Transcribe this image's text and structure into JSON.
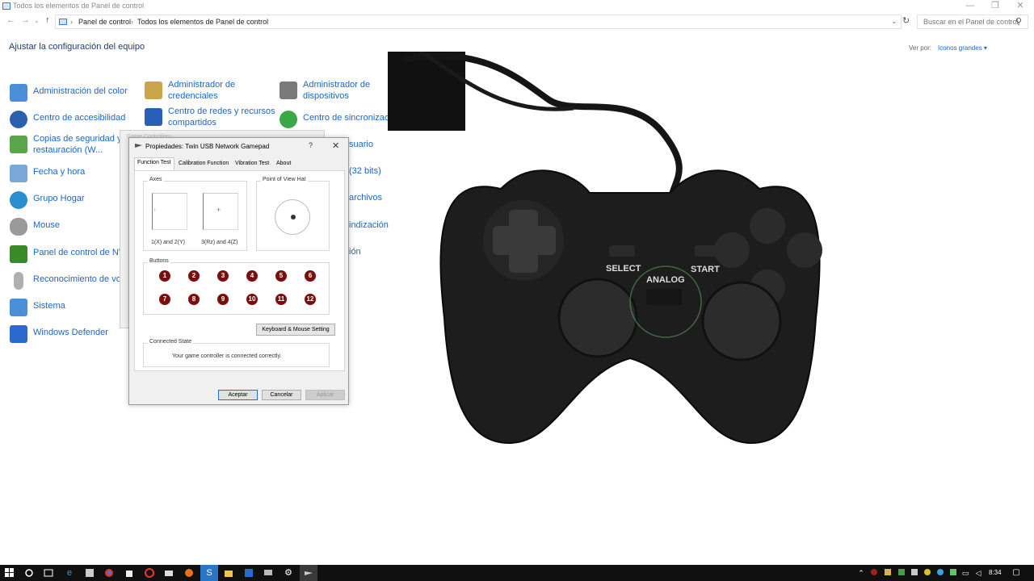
{
  "window": {
    "title": "Todos los elementos de Panel de control",
    "minimize": "—",
    "restore": "❐",
    "close": "✕"
  },
  "address": {
    "back": "←",
    "forward": "→",
    "recent": "⌄",
    "up": "↑",
    "crumbs": [
      "Panel de control",
      "Todos los elementos de Panel de control"
    ],
    "separator": "›",
    "dropdown": "⌄",
    "refresh": "↻",
    "search_placeholder": "Buscar en el Panel de control",
    "search_glyph": "⚲"
  },
  "page": {
    "heading": "Ajustar la configuración del equipo",
    "view_by_label": "Ver por:",
    "view_by_value": "Iconos grandes ▾"
  },
  "items": [
    {
      "label": "Administración del color",
      "icon": "color-management-icon",
      "color": "#4a8fd8"
    },
    {
      "label": "Centro de accesibilidad",
      "icon": "accessibility-icon",
      "color": "#2b5fb0"
    },
    {
      "label": "Copias de seguridad y\nrestauración (W...",
      "icon": "backup-icon",
      "color": "#5aa54a"
    },
    {
      "label": "Fecha y hora",
      "icon": "clock-icon",
      "color": "#7aa7d6"
    },
    {
      "label": "Grupo Hogar",
      "icon": "homegroup-icon",
      "color": "#2a8fd0"
    },
    {
      "label": "Mouse",
      "icon": "mouse-icon",
      "color": "#9a9a9a"
    },
    {
      "label": "Panel de control de NVI",
      "icon": "nvidia-icon",
      "color": "#3a8a2a"
    },
    {
      "label": "Reconocimiento de voz",
      "icon": "microphone-icon",
      "color": "#b0b0b0"
    },
    {
      "label": "Sistema",
      "icon": "system-icon",
      "color": "#4a8fd8"
    },
    {
      "label": "Windows Defender",
      "icon": "defender-icon",
      "color": "#2a6ad0"
    },
    {
      "label": "Administrador de\ncredenciales",
      "icon": "credentials-icon",
      "color": "#c9a64a"
    },
    {
      "label": "Centro de redes y recursos\ncompartidos",
      "icon": "network-icon",
      "color": "#2a5fb8"
    },
    {
      "label": "Administrador de\ndispositivos",
      "icon": "device-manager-icon",
      "color": "#7a7a7a"
    },
    {
      "label": "Centro de sincronizació",
      "icon": "sync-icon",
      "color": "#3aa844"
    },
    {
      "label": "suario",
      "icon": "",
      "color": ""
    },
    {
      "label": "(32 bits)",
      "icon": "",
      "color": ""
    },
    {
      "label": "archivos",
      "icon": "",
      "color": ""
    },
    {
      "label": "indización",
      "icon": "",
      "color": ""
    },
    {
      "label": "ión",
      "icon": "",
      "color": ""
    }
  ],
  "ghost_dialog": {
    "title": "Game Controllers"
  },
  "dialog": {
    "title": "Propiedades: Twin USB Network Gamepad",
    "help": "?",
    "close": "✕",
    "tabs": [
      "Function Test",
      "Calibration Function",
      "Vibration Test",
      "About"
    ],
    "axes_label": "Axes",
    "axis1_label": "1(X) and 2(Y)",
    "axis2_label": "3(Rz) and 4(Z)",
    "axis_marker": "+",
    "pov_label": "Point of View Hat",
    "buttons_label": "Buttons",
    "buttons": [
      "1",
      "2",
      "3",
      "4",
      "5",
      "6",
      "7",
      "8",
      "9",
      "10",
      "11",
      "12"
    ],
    "button_color": "#7a0d0d",
    "keyboard_mouse_button": "Keyboard & Mouse Setting",
    "connected_label": "Connected State",
    "connected_message": "Your game controller is connected correctly.",
    "ok": "Aceptar",
    "cancel": "Cancelar",
    "apply": "Aplicar"
  },
  "gamepad": {
    "select": "SELECT",
    "start": "START",
    "analog": "ANALOG"
  },
  "taskbar": {
    "time": "8:34",
    "icons": [
      "start-icon",
      "search-icon",
      "task-view-icon",
      "edge-icon",
      "store-icon",
      "chrome-icon",
      "store-bag-icon",
      "opera-icon",
      "media-icon",
      "firefox-icon",
      "skype-icon",
      "file-explorer-icon",
      "outlook-icon",
      "monitor-icon",
      "settings-icon",
      "gamepad-icon"
    ]
  }
}
